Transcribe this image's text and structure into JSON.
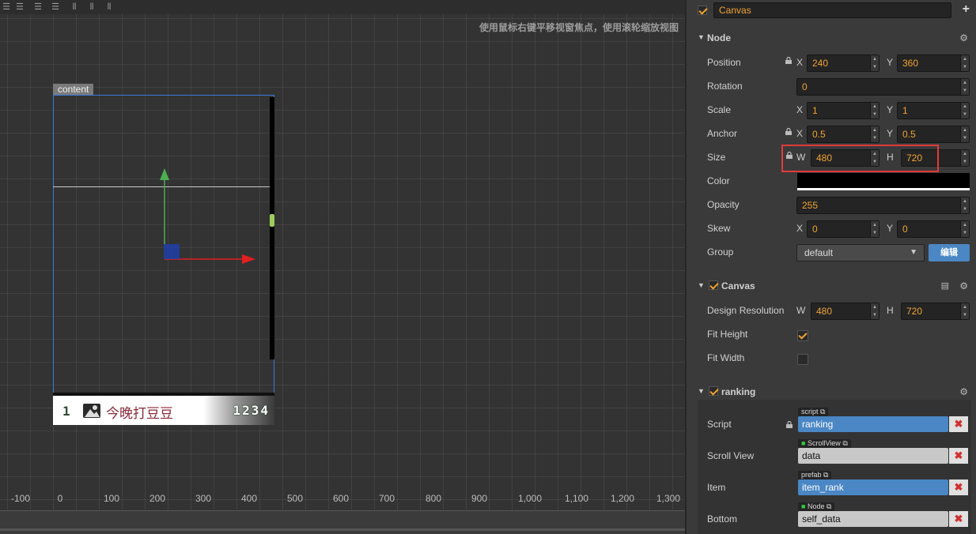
{
  "scene": {
    "hint": "使用鼠标右键平移视窗焦点，使用滚轮缩放视图",
    "content_label": "content",
    "ruler_ticks": [
      "-100",
      "0",
      "100",
      "200",
      "300",
      "400",
      "500",
      "600",
      "700",
      "800",
      "900",
      "1,000",
      "1,100",
      "1,200",
      "1,300"
    ],
    "rank_item": {
      "rank": "1",
      "name": "今晚打豆豆",
      "score": "1234"
    }
  },
  "inspector": {
    "node_name": "Canvas",
    "node_section": {
      "title": "Node",
      "position": {
        "label": "Position",
        "x": "240",
        "y": "360"
      },
      "rotation": {
        "label": "Rotation",
        "value": "0"
      },
      "scale": {
        "label": "Scale",
        "x": "1",
        "y": "1"
      },
      "anchor": {
        "label": "Anchor",
        "x": "0.5",
        "y": "0.5"
      },
      "size": {
        "label": "Size",
        "w": "480",
        "h": "720"
      },
      "color": {
        "label": "Color",
        "value": "#000000"
      },
      "opacity": {
        "label": "Opacity",
        "value": "255"
      },
      "skew": {
        "label": "Skew",
        "x": "0",
        "y": "0"
      },
      "group": {
        "label": "Group",
        "value": "default",
        "edit_label": "编辑"
      }
    },
    "canvas_section": {
      "title": "Canvas",
      "design_resolution": {
        "label": "Design Resolution",
        "w": "480",
        "h": "720"
      },
      "fit_height": {
        "label": "Fit Height",
        "checked": true
      },
      "fit_width": {
        "label": "Fit Width",
        "checked": false
      }
    },
    "ranking_section": {
      "title": "ranking",
      "script": {
        "label": "Script",
        "tag": "script",
        "value": "ranking"
      },
      "scroll_view": {
        "label": "Scroll View",
        "tag": "ScrollView",
        "value": "data"
      },
      "item": {
        "label": "Item",
        "tag": "prefab",
        "value": "item_rank"
      },
      "bottom": {
        "label": "Bottom",
        "tag": "Node",
        "value": "self_data"
      }
    },
    "axis": {
      "x": "X",
      "y": "Y",
      "w": "W",
      "h": "H"
    }
  },
  "colors": {
    "accent": "#f0a433",
    "selection": "#3b7be0",
    "highlight": "#e23a3a",
    "ref_blue": "#4a87c4"
  }
}
